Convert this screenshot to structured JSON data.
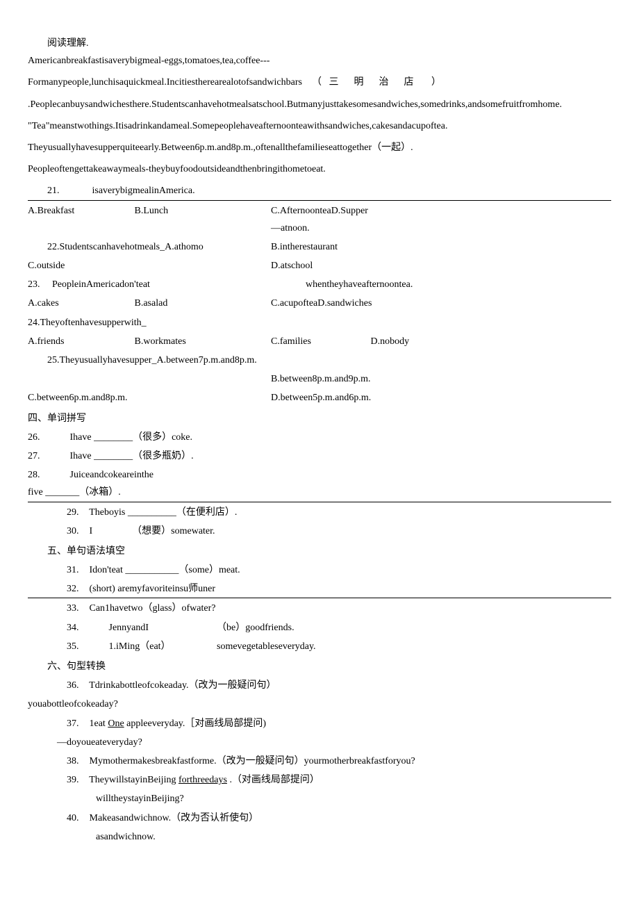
{
  "reading": {
    "title": "阅读理解.",
    "p1": "Americanbreakfastisaverybigmeal-eggs,tomatoes,tea,coffee---",
    "p2a": "Formanypeople,lunchisaquickmeal.Incitiestherearealotofsandwichbars",
    "p2b": "（",
    "p2c": "三明治店",
    "p2d": "）",
    "p3": ".Peoplecanbuysandwichesthere.Studentscanhavehotmealsatschool.Butmanyjusttakesomesandwiches,somedrinks,andsomefruitfromhome.",
    "p4": "\"Tea\"meanstwothings.Itisadrinkandameal.Somepeoplehaveafternoonteawithsandwiches,cakesandacupoftea.",
    "p5": "Theyusuallyhavesupperquiteearly.Between6p.m.and8p.m.,oftenallthefamilieseattogether（一起）.",
    "p6": "Peopleoftengettakeawaymeals-theybuyfoodoutsideandthenbringithometoeat.",
    "q21": {
      "num": "21.",
      "stem": "isaverybigmealinAmerica.",
      "a": "A.Breakfast",
      "b": "B.Lunch",
      "right1": "C.AfternoonteaD.Supper",
      "right2": "—atnoon."
    },
    "q22": {
      "stem": "22.Studentscanhavehotmeals_A.athomo",
      "b": "B.intherestaurant",
      "c_left": "C.outside",
      "d": "D.atschool"
    },
    "q23": {
      "num": "23.",
      "stem": "PeopleinAmericadon'teat",
      "tail": "whentheyhaveafternoontea.",
      "a": "A.cakes",
      "b": "B.asalad",
      "cd": "C.acupofteaD.sandwiches"
    },
    "q24": {
      "stem": "24.Theyoftenhavesupperwith_",
      "a": "A.friends",
      "b": "B.workmates",
      "c": "C.families",
      "d": "D.nobody"
    },
    "q25": {
      "stem": "25.Theyusuallyhavesupper_A.between7p.m.and8p.m.",
      "b": "B.between8p.m.and9p.m.",
      "c": "C.between6p.m.and8p.m.",
      "d": "D.between5p.m.and6p.m."
    }
  },
  "sec4": {
    "title": "四、单词拼写",
    "q26": {
      "num": "26.",
      "text": "Ihave ________（很多）coke."
    },
    "q27": {
      "num": "27.",
      "text": "Ihave ________（很多瓶奶）."
    },
    "q28": {
      "num": "28.",
      "text1": "Juiceandcokeareinthe",
      "text2": "five _______（冰箱）."
    },
    "q29": {
      "num": "29.",
      "text": "Theboyis __________（在便利店）."
    },
    "q30": {
      "num": "30.",
      "text": "I",
      "text2": "（想要）somewater."
    }
  },
  "sec5": {
    "title": "五、单句语法填空",
    "q31": {
      "num": "31.",
      "text": "Idon'teat ___________（some）meat."
    },
    "q32": {
      "num": "32.",
      "text": "(short) aremyfavoriteinsu师uner"
    },
    "q33": {
      "num": "33.",
      "text": "Can1havetwo（glass）ofwater?"
    },
    "q34": {
      "num": "34.",
      "text1": "JennyandI",
      "text2": "（be）goodfriends."
    },
    "q35": {
      "num": "35.",
      "text1": "1.iMing（eat）",
      "text2": "somevegetableseveryday."
    }
  },
  "sec6": {
    "title": "六、句型转换",
    "q36": {
      "num": "36.",
      "text": "Tdrinkabottleofcokeaday.（改为一般疑问句）",
      "ans": "youabottleofcokeaday?"
    },
    "q37": {
      "num": "37.",
      "text1": "1eat",
      "u": "One",
      "text2": "appleeveryday.［对画线局部提问)",
      "ans": "—doyoueateveryday?"
    },
    "q38": {
      "num": "38.",
      "text": "Mymothermakesbreakfastforme.（改为一般疑问句）yourmotherbreakfastforyou?"
    },
    "q39": {
      "num": "39.",
      "text1": "TheywillstayinBeijing",
      "u": "forthreedays",
      "text2": ".（对画线局部提问）",
      "ans": "willtheystayinBeijing?"
    },
    "q40": {
      "num": "40.",
      "text": "Makeasandwichnow.（改为否认祈使句）",
      "ans": "asandwichnow."
    }
  }
}
